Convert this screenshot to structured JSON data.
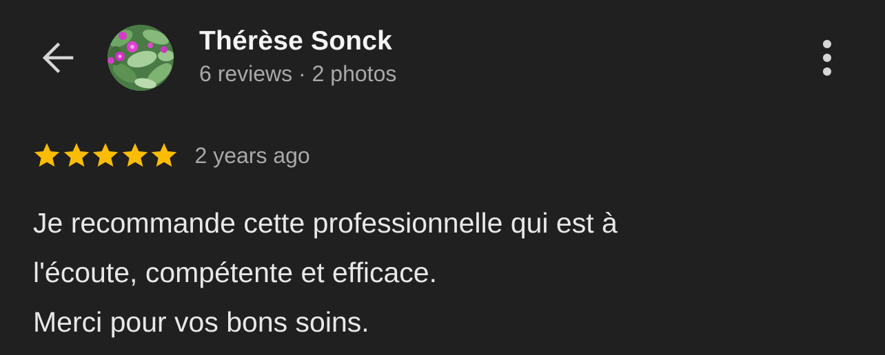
{
  "header": {
    "back_icon": "arrow-left-icon",
    "avatar_image": "flowers-avatar",
    "user_name": "Thérèse Sonck",
    "user_stats": "6 reviews · 2 photos",
    "more_icon": "more-vertical-icon"
  },
  "review": {
    "rating": 5,
    "rating_max": 5,
    "star_color": "#FBBC04",
    "time": "2 years ago",
    "text_lines": [
      "Je recommande cette professionnelle qui est à",
      "l'écoute, compétente et efficace.",
      "Merci pour vos bons soins."
    ]
  },
  "colors": {
    "background": "#202020",
    "primary_text": "#F4F4F4",
    "secondary_text": "#A9A9A9"
  }
}
